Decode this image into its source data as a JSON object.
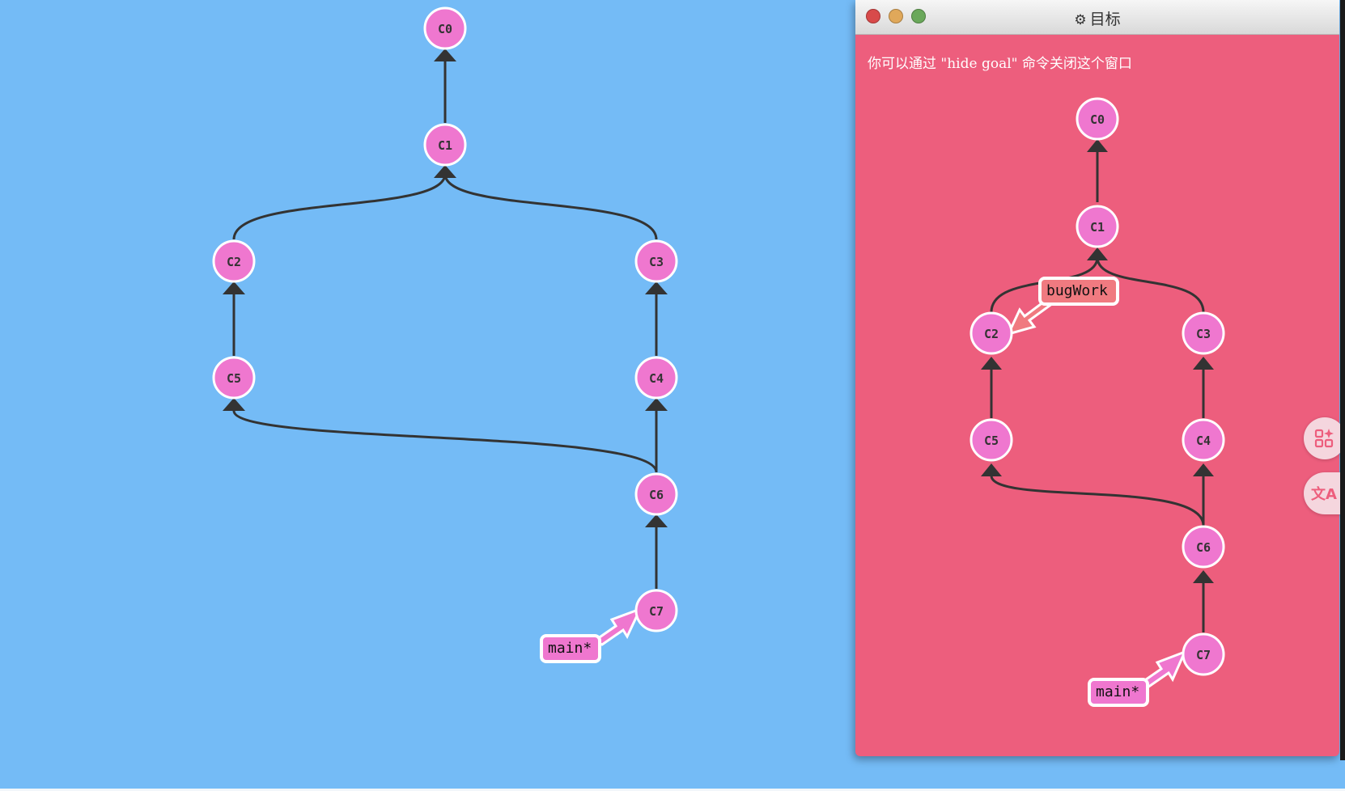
{
  "colors": {
    "background": "#74bbf6",
    "goal_background": "#ed5e7d",
    "commit_fill": "#ef77cf",
    "edge": "#333333",
    "main_branch_fill": "#ef77cf",
    "bugwork_branch_fill": "#f07a80"
  },
  "main_tree": {
    "commits": [
      "C0",
      "C1",
      "C2",
      "C3",
      "C4",
      "C5",
      "C6",
      "C7"
    ],
    "branches": [
      {
        "name": "main*",
        "target": "C7"
      }
    ]
  },
  "goal_window": {
    "title": "目标",
    "title_icon": "gear-icon",
    "hint": "你可以通过 \"hide goal\" 命令关闭这个窗口",
    "commits": [
      "C0",
      "C1",
      "C2",
      "C3",
      "C4",
      "C5",
      "C6",
      "C7"
    ],
    "branches": [
      {
        "name": "bugWork",
        "target": "C2"
      },
      {
        "name": "main*",
        "target": "C7"
      }
    ]
  },
  "side_buttons": [
    {
      "icon": "apps-sparkle-icon"
    },
    {
      "icon": "translate-icon",
      "glyph": "文A"
    }
  ]
}
